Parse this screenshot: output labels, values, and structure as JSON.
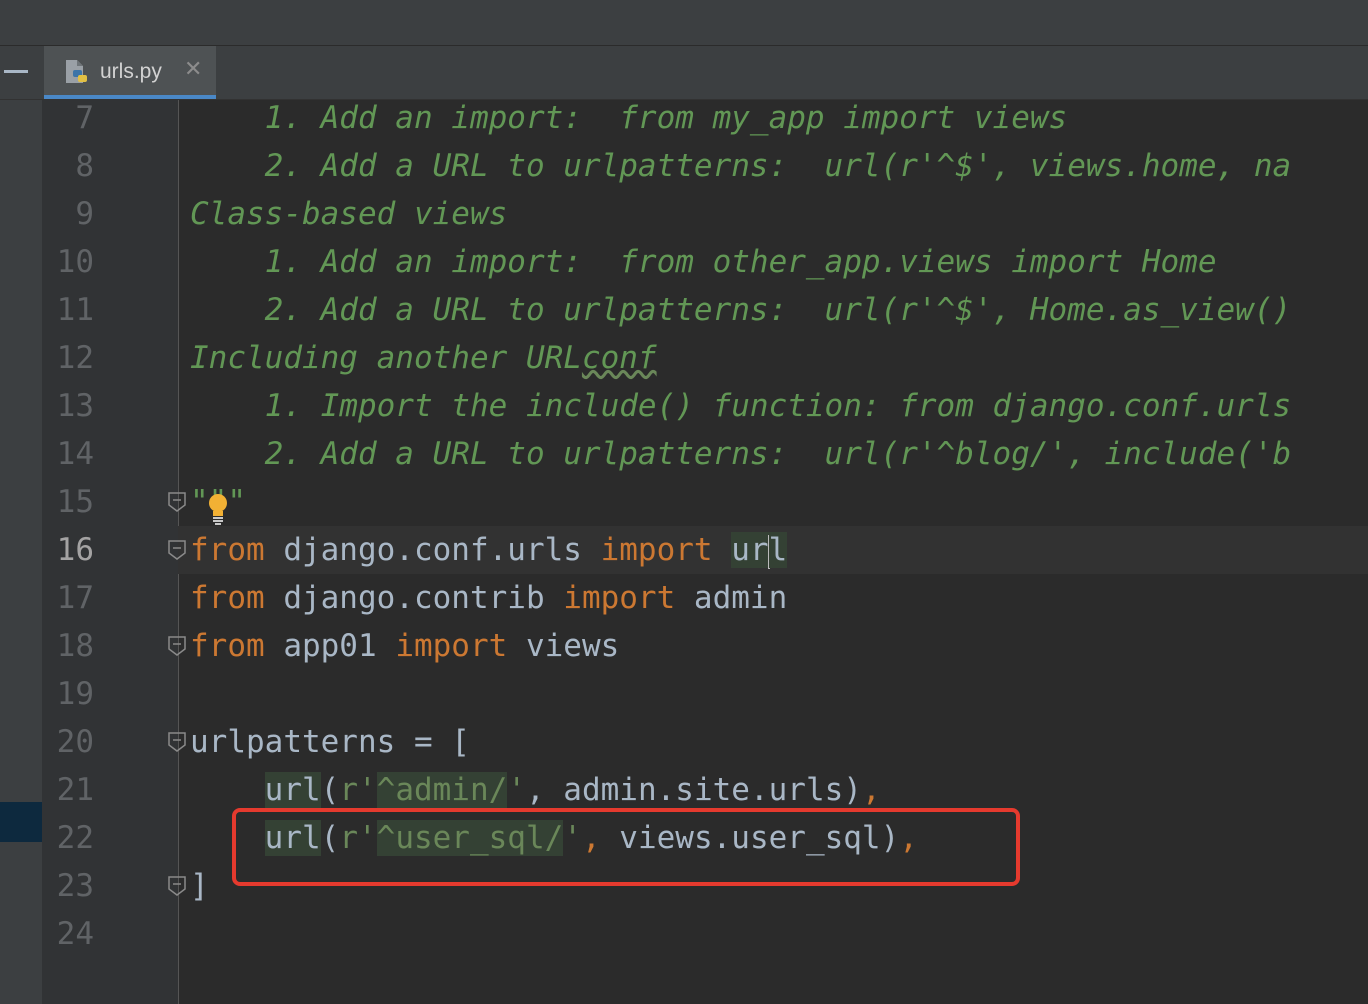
{
  "tab": {
    "filename": "urls.py",
    "close_glyph": "✕"
  },
  "icons": {
    "file_icon": "python-file-icon",
    "close": "close-icon",
    "fold": "fold-marker-icon",
    "intention": "lightbulb-icon"
  },
  "colors": {
    "keyword": "#cc7832",
    "string": "#6a8759",
    "docstring": "#629755",
    "identifier": "#a9b7c6",
    "annotation_box": "#e53a2e",
    "tab_underline": "#4a88c7"
  },
  "editor": {
    "current_line_number": "16",
    "lines": [
      {
        "n": "7",
        "segments": [
          {
            "t": "    1. Add an import:  from my_app import views",
            "c": "doc"
          }
        ]
      },
      {
        "n": "8",
        "segments": [
          {
            "t": "    2. Add a URL to urlpatterns:  url(r'^$', views.home, na",
            "c": "doc"
          }
        ]
      },
      {
        "n": "9",
        "segments": [
          {
            "t": "Class-based views",
            "c": "doc"
          }
        ]
      },
      {
        "n": "10",
        "segments": [
          {
            "t": "    1. Add an import:  from other_app.views import Home",
            "c": "doc"
          }
        ]
      },
      {
        "n": "11",
        "segments": [
          {
            "t": "    2. Add a URL to urlpatterns:  url(r'^$', Home.as_view()",
            "c": "doc"
          }
        ]
      },
      {
        "n": "12",
        "segments": [
          {
            "t": "Including another URL",
            "c": "doc"
          },
          {
            "t": "conf",
            "c": "doc wavy"
          }
        ]
      },
      {
        "n": "13",
        "segments": [
          {
            "t": "    1. Import the include() function: from django.conf.urls",
            "c": "doc"
          }
        ]
      },
      {
        "n": "14",
        "segments": [
          {
            "t": "    2. Add a URL to urlpatterns:  url(r'^blog/', include('b",
            "c": "doc"
          }
        ]
      },
      {
        "n": "15",
        "segments": [
          {
            "t": "\"\"\"",
            "c": "doc"
          }
        ],
        "fold": true
      },
      {
        "n": "16",
        "segments": [
          {
            "t": "from",
            "c": "kw"
          },
          {
            "t": " django.conf.urls ",
            "c": ""
          },
          {
            "t": "import",
            "c": "kw"
          },
          {
            "t": " ",
            "c": ""
          },
          {
            "t": "ur",
            "c": "hl"
          },
          {
            "caret": true
          },
          {
            "t": "l",
            "c": "hl"
          }
        ],
        "fold": true
      },
      {
        "n": "17",
        "segments": [
          {
            "t": "from",
            "c": "kw"
          },
          {
            "t": " django.contrib ",
            "c": ""
          },
          {
            "t": "import",
            "c": "kw"
          },
          {
            "t": " admin",
            "c": ""
          }
        ]
      },
      {
        "n": "18",
        "segments": [
          {
            "t": "from",
            "c": "kw"
          },
          {
            "t": " app01 ",
            "c": ""
          },
          {
            "t": "import",
            "c": "kw"
          },
          {
            "t": " views",
            "c": ""
          }
        ],
        "fold": true
      },
      {
        "n": "19",
        "segments": []
      },
      {
        "n": "20",
        "segments": [
          {
            "t": "urlpatterns = [",
            "c": ""
          }
        ],
        "fold": true
      },
      {
        "n": "21",
        "segments": [
          {
            "t": "    ",
            "c": ""
          },
          {
            "t": "url",
            "c": "hl"
          },
          {
            "t": "(",
            "c": ""
          },
          {
            "t": "r'",
            "c": "str"
          },
          {
            "t": "^admin/",
            "c": "str hl"
          },
          {
            "t": "'",
            "c": "str"
          },
          {
            "t": ", admin.site.urls)",
            "c": ""
          },
          {
            "t": ",",
            "c": "kw"
          }
        ]
      },
      {
        "n": "22",
        "segments": [
          {
            "t": "    ",
            "c": ""
          },
          {
            "t": "url",
            "c": "hl"
          },
          {
            "t": "(",
            "c": ""
          },
          {
            "t": "r'",
            "c": "str"
          },
          {
            "t": "^user_sql/",
            "c": "str hl"
          },
          {
            "t": "'",
            "c": "str"
          },
          {
            "t": ",",
            "c": "kw"
          },
          {
            "t": " views.user_sql)",
            "c": ""
          },
          {
            "t": ",",
            "c": "kw"
          }
        ]
      },
      {
        "n": "23",
        "segments": [
          {
            "t": "]",
            "c": ""
          }
        ],
        "fold": true
      },
      {
        "n": "24",
        "segments": []
      }
    ]
  }
}
